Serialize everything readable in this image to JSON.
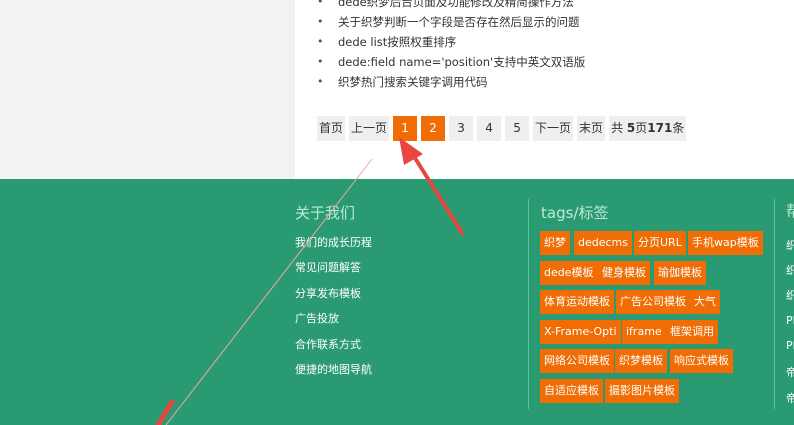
{
  "article_list": [
    "dede织梦后台页面及功能修改及精简操作方法",
    "关于织梦判断一个字段是否存在然后显示的问题",
    "dede list按照权重排序",
    "dede:field name='position'支持中英文双语版",
    "织梦热门搜索关键字调用代码"
  ],
  "bullet": "•",
  "pagination": {
    "first": "首页",
    "prev": "上一页",
    "pages": [
      "1",
      "2",
      "3",
      "4",
      "5"
    ],
    "next": "下一页",
    "last": "末页",
    "total_prefix": "共",
    "total_pages": "5",
    "pages_unit": "页",
    "total_items": "171",
    "items_unit": "条"
  },
  "footer": {
    "about": {
      "title": "关于我们",
      "links": [
        "我们的成长历程",
        "常见问题解答",
        "分享发布模板",
        "广告投放",
        "合作联系方式",
        "便捷的地图导航"
      ]
    },
    "tags": {
      "title": "tags/标签",
      "items": [
        "织梦",
        "dedecms",
        "分页URL",
        "手机wap模板",
        "dede模板",
        "健身模板",
        "瑜伽模板",
        "体育运动模板",
        "广告公司模板",
        "大气",
        "X-Frame-Opti",
        "iframe",
        "框架调用",
        "网络公司模板",
        "织梦模板",
        "响应式模板",
        "自适应模板",
        "摄影图片模板"
      ]
    },
    "right_col": {
      "title": "帮",
      "items": [
        "织",
        "织",
        "织",
        "Pl",
        "Pl",
        "帝",
        "帝"
      ]
    }
  },
  "colors": {
    "accent": "#f06d05",
    "footer_bg": "#2a9a72",
    "annotation_arrow": "#e8473f"
  }
}
